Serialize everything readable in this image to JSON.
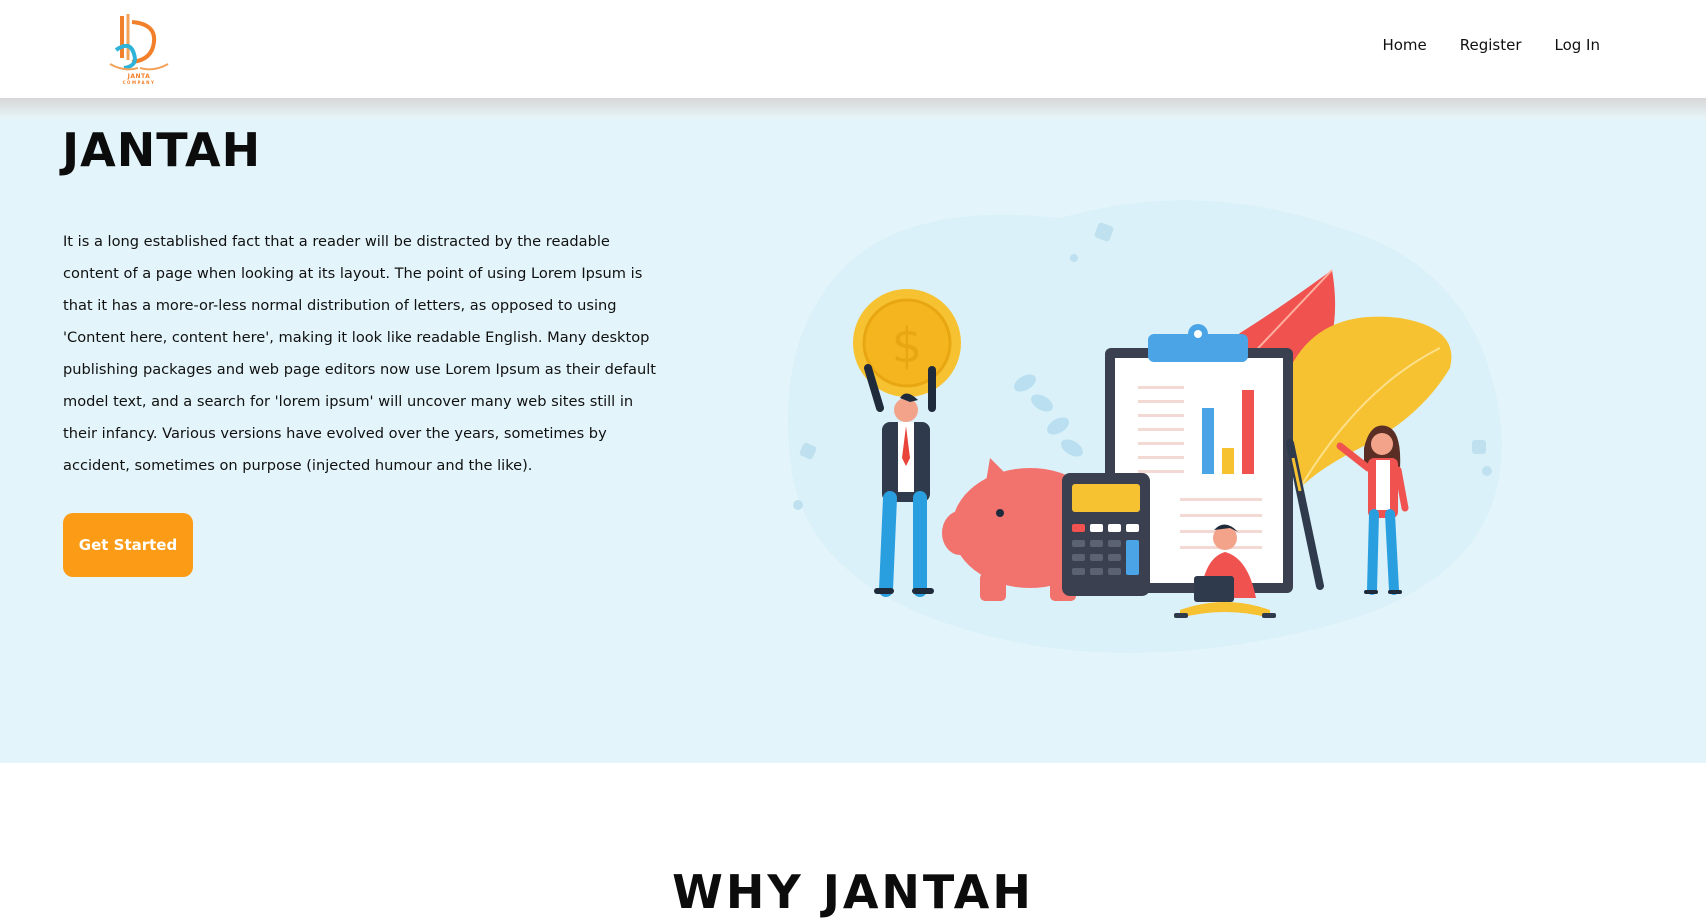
{
  "brand": {
    "logo_text": "JANTA",
    "logo_subtext": "COMPANY"
  },
  "nav": {
    "items": [
      {
        "label": "Home"
      },
      {
        "label": "Register"
      },
      {
        "label": "Log In"
      }
    ]
  },
  "hero": {
    "title": "JANTAH",
    "paragraph": "It is a long established fact that a reader will be distracted by the readable content of a page when looking at its layout. The point of using Lorem Ipsum is that it has a more-or-less normal distribution of letters, as opposed to using 'Content here, content here', making it look like readable English. Many desktop publishing packages and web page editors now use Lorem Ipsum as their default model text, and a search for 'lorem ipsum' will uncover many web sites still in their infancy. Various versions have evolved over the years, sometimes by accident, sometimes on purpose (injected humour and the like).",
    "cta_label": "Get Started",
    "illustration": {
      "coin_symbol": "$",
      "icons": [
        "coin-icon",
        "piggy-bank-icon",
        "calculator-icon",
        "clipboard-chart-icon",
        "leaf-icon",
        "pen-icon"
      ]
    }
  },
  "why": {
    "title": "WHY JANTAH"
  },
  "colors": {
    "accent": "#fc9b16",
    "hero_bg": "#e3f5fb",
    "text": "#111111"
  }
}
